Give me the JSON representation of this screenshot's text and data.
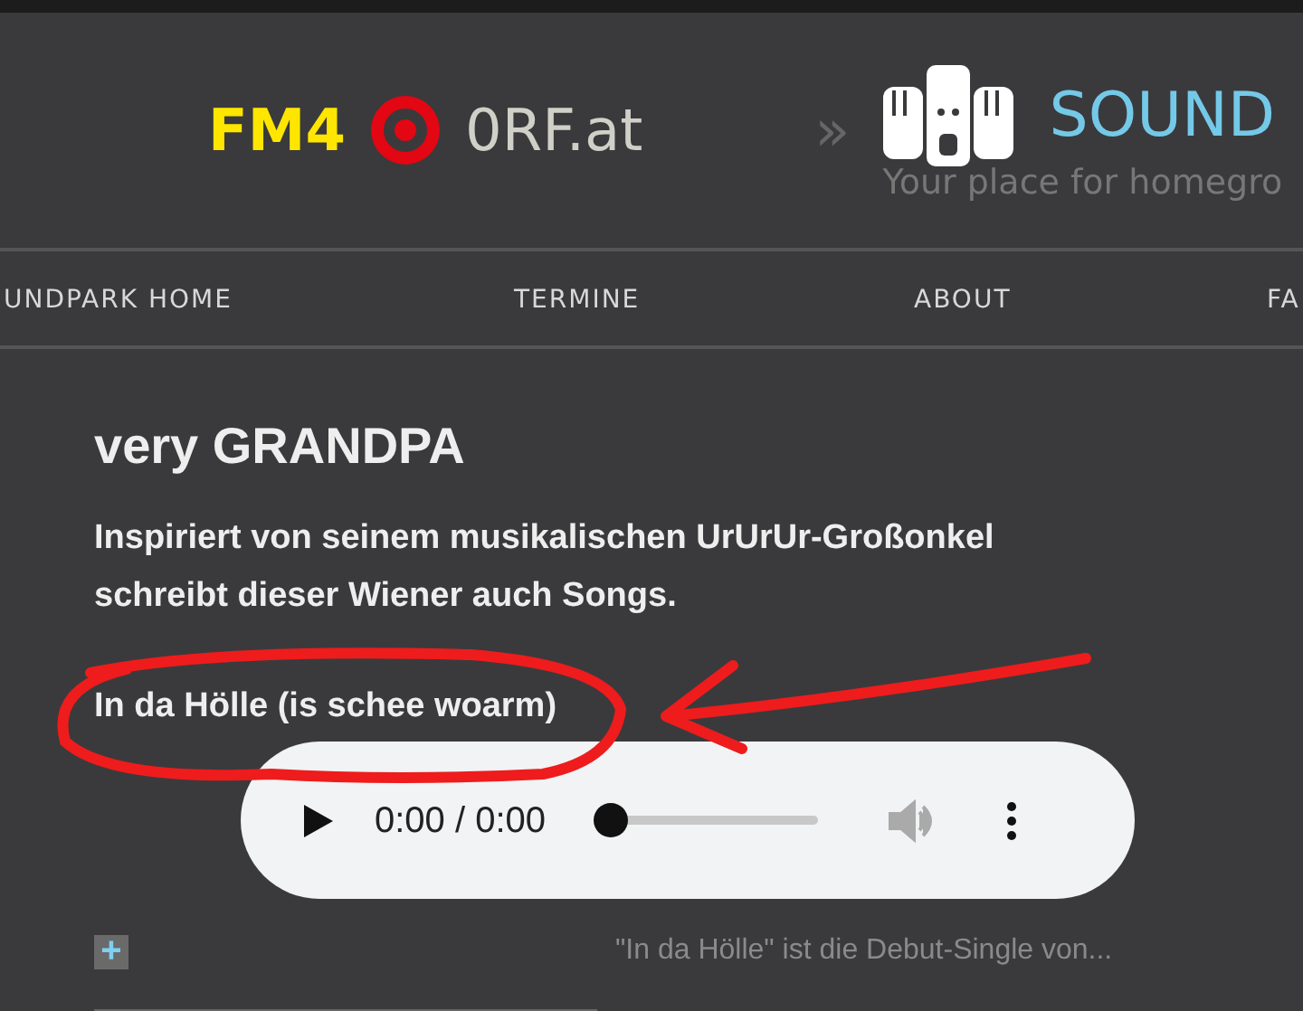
{
  "header": {
    "fm4_logo": "FM4",
    "orf_logo": "0RF.at",
    "separator": "»",
    "site_name": "SOUND",
    "tagline": "Your place for homegro"
  },
  "nav": {
    "items": [
      {
        "label": "UNDPARK HOME"
      },
      {
        "label": "TERMINE"
      },
      {
        "label": "ABOUT"
      },
      {
        "label": "FA"
      }
    ]
  },
  "article": {
    "title": "very GRANDPA",
    "intro": "Inspiriert von seinem musikalischen UrUrUr-Großonkel schreibt dieser Wiener auch Songs.",
    "track_title": "In da Hölle (is schee woarm)",
    "player": {
      "time": "0:00 / 0:00",
      "level": 0
    },
    "expand_icon": "+",
    "teaser": "\"In da Hölle\" ist die Debut-Single von..."
  }
}
